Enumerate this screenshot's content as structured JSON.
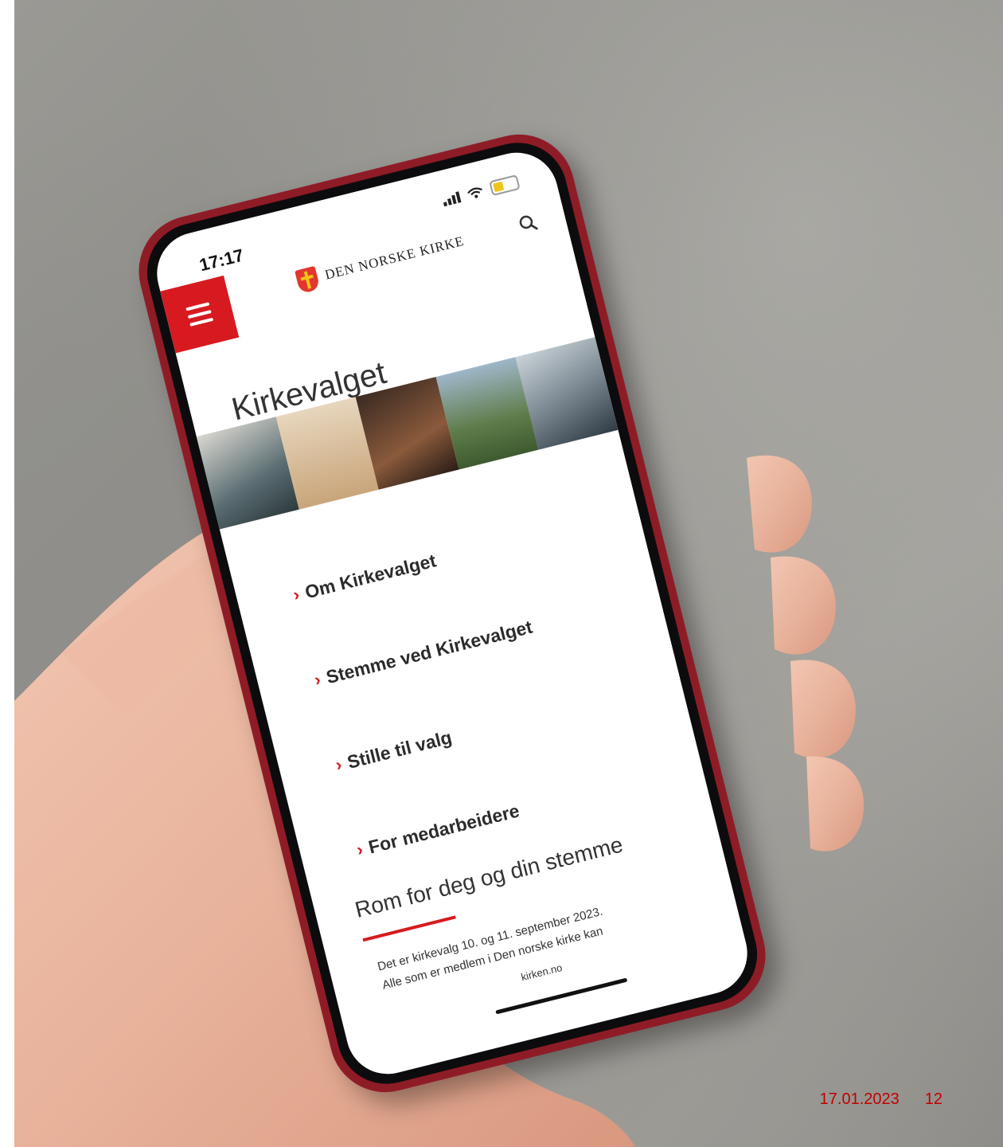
{
  "phone": {
    "status_time": "17:17",
    "site": {
      "logo_text": "DEN NORSKE KIRKE",
      "page_title": "Kirkevalget",
      "menu_items": [
        {
          "label": "Om Kirkevalget"
        },
        {
          "label": "Stemme ved Kirkevalget"
        },
        {
          "label": "Stille til valg"
        },
        {
          "label": "For medarbeidere"
        }
      ],
      "section_title": "Rom for deg og din stemme",
      "section_body_line1": "Det er kirkevalg 10. og 11. september 2023.",
      "section_body_line2": "Alle som er medlem i Den norske kirke kan",
      "url": "kirken.no"
    },
    "colors": {
      "accent": "#d71920",
      "phone_case": "#8e1c26"
    }
  },
  "slide_footer": {
    "date": "17.01.2023",
    "page_number": "12"
  }
}
